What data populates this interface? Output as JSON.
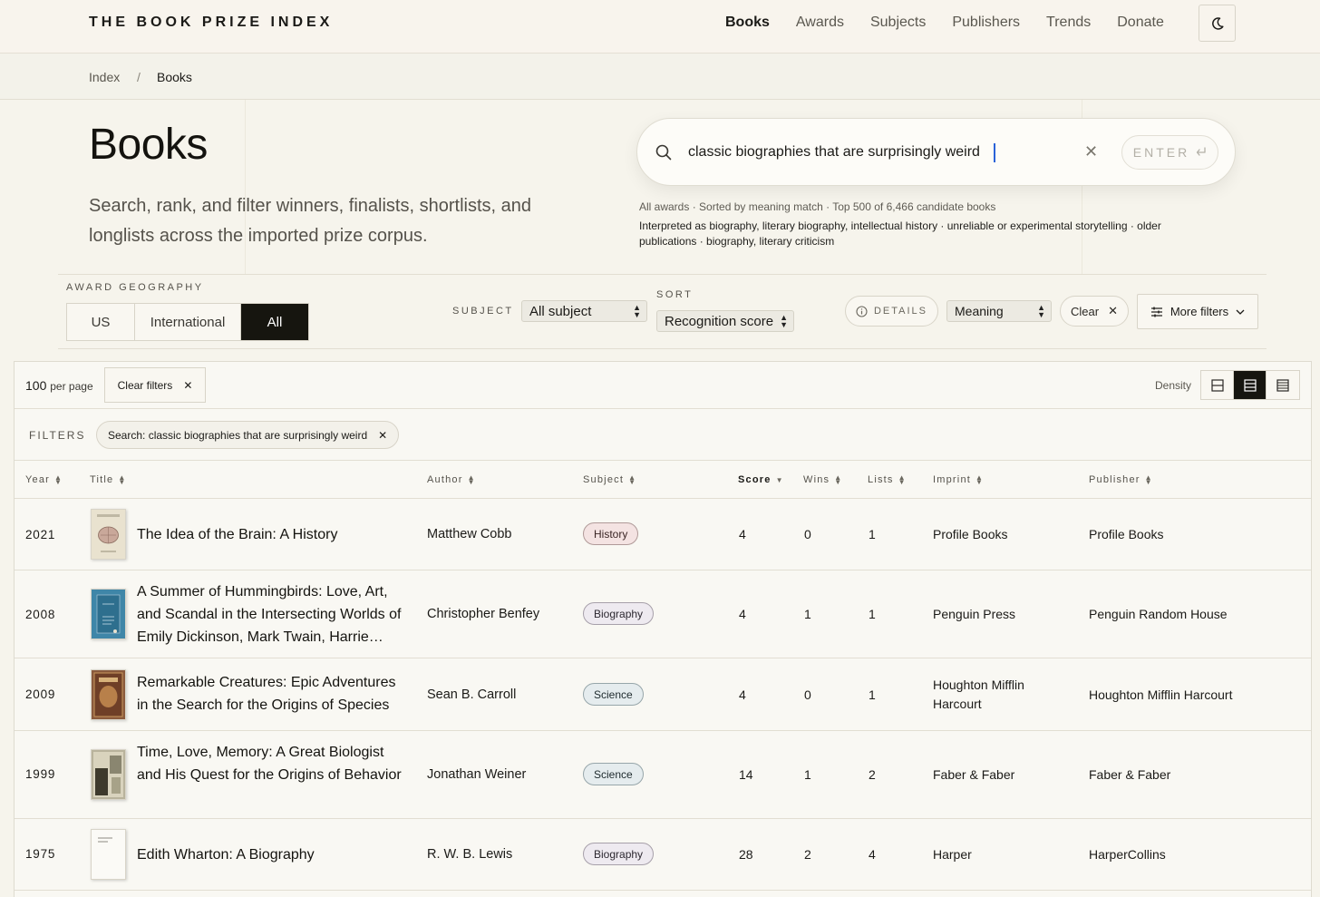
{
  "brand": "THE BOOK PRIZE INDEX",
  "nav": [
    {
      "label": "Books",
      "active": true
    },
    {
      "label": "Awards"
    },
    {
      "label": "Subjects"
    },
    {
      "label": "Publishers"
    },
    {
      "label": "Trends"
    },
    {
      "label": "Donate"
    }
  ],
  "theme_toggle_icon": "moon-icon",
  "breadcrumb": {
    "root": "Index",
    "separator": "/",
    "current": "Books"
  },
  "hero": {
    "title": "Books",
    "subtitle": "Search, rank, and filter winners, finalists, shortlists, and longlists across the imported prize corpus."
  },
  "search": {
    "value": "classic biographies that are surprisingly weird",
    "clear_icon": "close-icon",
    "enter_label": "ENTER",
    "enter_icon": "return-arrow-icon",
    "meta": "All awards · Sorted by meaning match · Top 500 of 6,466 candidate books",
    "interpreted": "Interpreted as biography, literary biography, intellectual history · unreliable or experimental storytelling · older publications · biography, literary criticism"
  },
  "filters_bar": {
    "geo_label": "AWARD GEOGRAPHY",
    "geo_options": [
      "US",
      "International",
      "All"
    ],
    "geo_selected": "All",
    "subject_label": "SUBJECT",
    "subject_value": "All subject",
    "sort_label": "SORT",
    "sort_value": "Recognition score",
    "details_label": "DETAILS",
    "mode_value": "Meaning",
    "clear_label": "Clear",
    "more_label": "More filters"
  },
  "results": {
    "per_page_count": "100",
    "per_page_text": "per page",
    "clear_filters_label": "Clear filters",
    "density_label": "Density",
    "density_selected": 1,
    "filters_label": "FILTERS",
    "active_chip": "Search: classic biographies that are surprisingly weird",
    "columns": [
      "Year",
      "Title",
      "Author",
      "Subject",
      "Score",
      "Wins",
      "Lists",
      "Imprint",
      "Publisher"
    ],
    "sorted_column": "Score",
    "rows": [
      {
        "year": "2021",
        "title": "The Idea of the Brain: A History",
        "author": "Matthew Cobb",
        "subject": "History",
        "score": "4",
        "wins": "0",
        "lists": "1",
        "imprint": "Profile Books",
        "publisher": "Profile Books",
        "cover_color": "#e9e2cf"
      },
      {
        "year": "2008",
        "title": "A Summer of Hummingbirds: Love, Art, and Scandal in the Intersecting Worlds of Emily Dickinson, Mark Twain, Harrie…",
        "author": "Christopher Benfey",
        "subject": "Biography",
        "score": "4",
        "wins": "1",
        "lists": "1",
        "imprint": "Penguin Press",
        "publisher": "Penguin Random House",
        "cover_color": "#3f86a8"
      },
      {
        "year": "2009",
        "title": "Remarkable Creatures: Epic Adventures in the Search for the Origins of Species",
        "author": "Sean B. Carroll",
        "subject": "Science",
        "score": "4",
        "wins": "0",
        "lists": "1",
        "imprint": "Houghton Mifflin Harcourt",
        "publisher": "Houghton Mifflin Harcourt",
        "cover_color": "#8a5a3c"
      },
      {
        "year": "1999",
        "title": "Time, Love, Memory: A Great Biologist and His Quest for the Origins of Behavior",
        "author": "Jonathan Weiner",
        "subject": "Science",
        "score": "14",
        "wins": "1",
        "lists": "2",
        "imprint": "Faber & Faber",
        "publisher": "Faber & Faber",
        "cover_color": "#b9b39c"
      },
      {
        "year": "1975",
        "title": "Edith Wharton: A Biography",
        "author": "R. W. B. Lewis",
        "subject": "Biography",
        "score": "28",
        "wins": "2",
        "lists": "4",
        "imprint": "Harper",
        "publisher": "HarperCollins",
        "cover_color": "#fbfaf6"
      }
    ]
  }
}
